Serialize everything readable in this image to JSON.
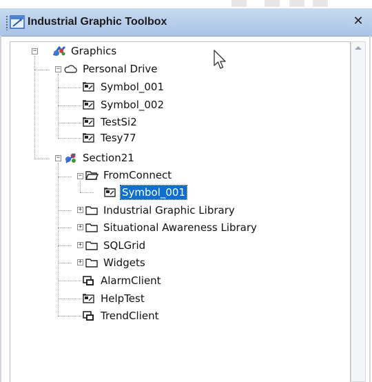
{
  "window": {
    "title": "Industrial Graphic Toolbox",
    "close_glyph": "✕"
  },
  "tree": {
    "root": {
      "label": "Graphics",
      "icon": "graphics-icon",
      "expanded": true
    },
    "personal_drive": {
      "label": "Personal Drive",
      "icon": "cloud-icon",
      "expanded": true,
      "children": [
        "Symbol_001",
        "Symbol_002",
        "TestSi2",
        "Tesy77"
      ]
    },
    "section": {
      "label": "Section21",
      "icon": "section-icon",
      "expanded": true,
      "from_connect": {
        "label": "FromConnect",
        "expanded": true,
        "children": [
          {
            "label": "Symbol_001",
            "selected": true
          }
        ]
      },
      "folders": [
        "Industrial Graphic Library",
        "Situational Awareness Library",
        "SQLGrid",
        "Widgets"
      ],
      "items": [
        {
          "label": "AlarmClient",
          "icon": "client-control-icon"
        },
        {
          "label": "HelpTest",
          "icon": "symbol-icon"
        },
        {
          "label": "TrendClient",
          "icon": "client-control-icon"
        }
      ]
    }
  },
  "colors": {
    "titlebar": "#b8cfec",
    "selection": "#0f6fd1",
    "tree_lines": "#9a9a9a"
  }
}
